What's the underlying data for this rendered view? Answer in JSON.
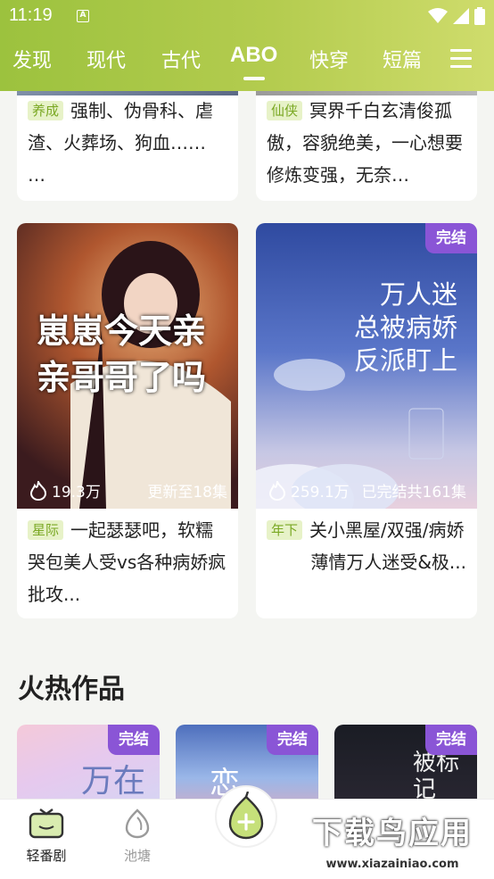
{
  "status_bar": {
    "time": "11:19",
    "notif_letter": "A"
  },
  "tabs": [
    {
      "label": "发现"
    },
    {
      "label": "现代"
    },
    {
      "label": "古代"
    },
    {
      "label": "ABO",
      "active": true
    },
    {
      "label": "快穿"
    },
    {
      "label": "短篇"
    }
  ],
  "top_cards": [
    {
      "tag": "养成",
      "text": "强制、伪骨科、虐渣、火葬场、狗血……",
      "more": "…"
    },
    {
      "tag": "仙侠",
      "text": "冥界千白玄清俊孤傲，容貌绝美，一心想要修炼变强，无奈…"
    }
  ],
  "mid_cards": [
    {
      "cover_title": "崽崽今天亲亲哥哥了吗",
      "plays": "19.3万",
      "status": "更新至18集",
      "tag": "星际",
      "text": "一起瑟瑟吧，软糯哭包美人受vs各种病娇疯批攻..."
    },
    {
      "badge": "完结",
      "cover_lines": [
        "万人迷",
        "总被病娇",
        "反派盯上"
      ],
      "plays": "259.1万",
      "status": "已完结共161集",
      "tag": "年下",
      "text": "关小黑屋/双强/病娇",
      "text2": "薄情万人迷受&极..."
    }
  ],
  "hot_section": {
    "title": "火热作品",
    "items": [
      {
        "badge": "完结",
        "cover_text": "万在"
      },
      {
        "badge": "完结",
        "cover_text": "恋"
      },
      {
        "badge": "完结",
        "cover_text": "被标记"
      }
    ]
  },
  "bottom_nav": [
    {
      "label": "轻番剧",
      "active": true
    },
    {
      "label": "池塘"
    }
  ],
  "watermark": {
    "line1": "下载鸟应用",
    "line2": "www.xiazainiao.com"
  },
  "colors": {
    "header_start": "#9cc23e",
    "header_end": "#cfdc6c",
    "badge": "#8a55d6",
    "tag_bg": "#e7f2c8",
    "tag_fg": "#7aa823"
  }
}
